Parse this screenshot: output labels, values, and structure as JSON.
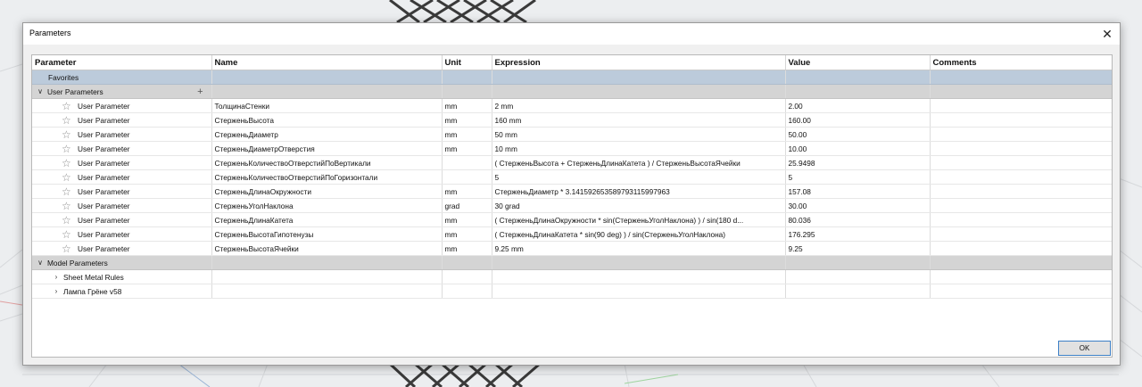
{
  "dialog": {
    "title": "Parameters",
    "close_icon": "close-icon"
  },
  "columns": {
    "parameter": "Parameter",
    "name": "Name",
    "unit": "Unit",
    "expression": "Expression",
    "value": "Value",
    "comments": "Comments"
  },
  "favorites_label": "Favorites",
  "user_params": {
    "label": "User Parameters",
    "rows": [
      {
        "type": "User Parameter",
        "name": "ТолщинаСтенки",
        "unit": "mm",
        "expression": "2 mm",
        "value": "2.00"
      },
      {
        "type": "User Parameter",
        "name": "СтерженьВысота",
        "unit": "mm",
        "expression": "160 mm",
        "value": "160.00"
      },
      {
        "type": "User Parameter",
        "name": "СтерженьДиаметр",
        "unit": "mm",
        "expression": "50 mm",
        "value": "50.00"
      },
      {
        "type": "User Parameter",
        "name": "СтерженьДиаметрОтверстия",
        "unit": "mm",
        "expression": "10 mm",
        "value": "10.00"
      },
      {
        "type": "User Parameter",
        "name": "СтерженьКоличествоОтверстийПоВертикали",
        "unit": "",
        "expression": "( СтерженьВысота + СтерженьДлинаКатета ) / СтерженьВысотаЯчейки",
        "value": "25.9498"
      },
      {
        "type": "User Parameter",
        "name": "СтерженьКоличествоОтверстийПоГоризонтали",
        "unit": "",
        "expression": "5",
        "value": "5"
      },
      {
        "type": "User Parameter",
        "name": "СтерженьДлинаОкружности",
        "unit": "mm",
        "expression": "СтерженьДиаметр * 3.141592653589793115997963",
        "value": "157.08"
      },
      {
        "type": "User Parameter",
        "name": "СтерженьУголНаклона",
        "unit": "grad",
        "expression": "30 grad",
        "value": "30.00"
      },
      {
        "type": "User Parameter",
        "name": "СтерженьДлинаКатета",
        "unit": "mm",
        "expression": "( СтерженьДлинаОкружности * sin(СтерженьУголНаклона) ) / sin(180 d...",
        "value": "80.036"
      },
      {
        "type": "User Parameter",
        "name": "СтерженьВысотаГипотенузы",
        "unit": "mm",
        "expression": "( СтерженьДлинаКатета * sin(90 deg) ) / sin(СтерженьУголНаклона)",
        "value": "176.295"
      },
      {
        "type": "User Parameter",
        "name": "СтерженьВысотаЯчейки",
        "unit": "mm",
        "expression": "9.25 mm",
        "value": "9.25"
      }
    ]
  },
  "model_params": {
    "label": "Model Parameters",
    "children": [
      "Sheet Metal Rules",
      "Лампа Грёне v58"
    ]
  },
  "ok_label": "OK",
  "colors": {
    "favorites_row": "#bccbdb",
    "group_row": "#d4d4d4",
    "ok_border": "#3c7fc6"
  }
}
